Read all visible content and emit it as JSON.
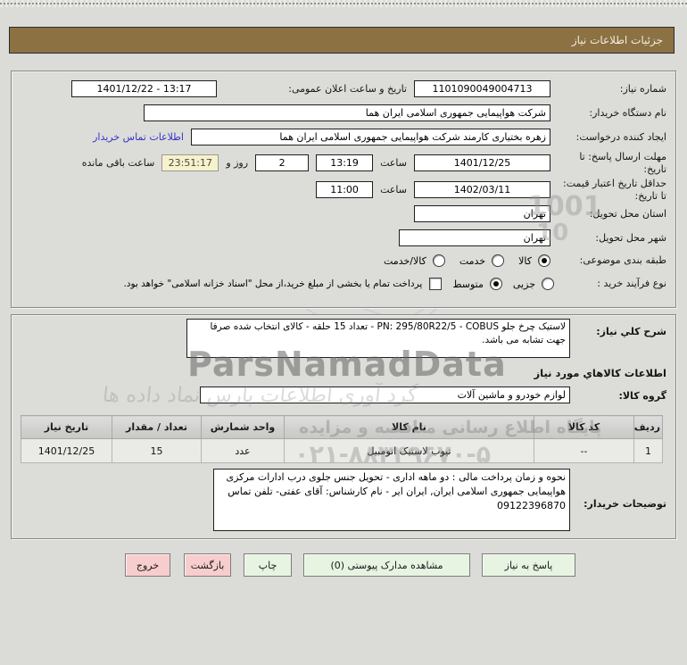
{
  "title_bar": {
    "text": "جزئیات اطلاعات نیاز"
  },
  "form": {
    "need_number": {
      "label": "شماره نیاز:",
      "value": "1101090049004713"
    },
    "announce_datetime": {
      "label": "تاریخ و ساعت اعلان عمومی:",
      "value": "13:17 - 1401/12/22"
    },
    "buyer_org": {
      "label": "نام دستگاه خریدار:",
      "value": "شرکت هواپیمایی جمهوری اسلامی ایران هما"
    },
    "request_creator": {
      "label": "ایجاد کننده درخواست:",
      "value": "زهره بختیاری کارمند شرکت هواپیمایی جمهوری اسلامی ایران هما",
      "contact_link": "اطلاعات تماس خریدار"
    },
    "response_deadline": {
      "label": "مهلت ارسال پاسخ: تا تاریخ:",
      "date": "1401/12/25",
      "hour_label": "ساعت",
      "time": "13:19",
      "days_value": "2",
      "days_label": "روز و",
      "countdown": "23:51:17",
      "countdown_label": "ساعت باقی مانده"
    },
    "price_validity": {
      "label": "حداقل تاریخ اعتبار قیمت: تا تاریخ:",
      "date": "1402/03/11",
      "hour_label": "ساعت",
      "time": "11:00"
    },
    "province": {
      "label": "استان محل تحویل:",
      "value": "تهران"
    },
    "city": {
      "label": "شهر محل تحویل:",
      "value": "تهران"
    },
    "subject_class": {
      "label": "طبقه بندی موضوعی:",
      "options": [
        {
          "label": "کالا",
          "selected": true
        },
        {
          "label": "خدمت",
          "selected": false
        },
        {
          "label": "کالا/خدمت",
          "selected": false
        }
      ]
    },
    "purchase_process": {
      "label": "نوع فرآیند خرید :",
      "options": [
        {
          "label": "جزیی",
          "selected": false
        },
        {
          "label": "متوسط",
          "selected": true
        }
      ],
      "checkbox_label": "پرداخت تمام یا بخشی از مبلغ خرید،از محل \"اسناد خزانه اسلامی\" خواهد بود.",
      "checkbox_checked": false
    }
  },
  "need_section": {
    "desc_label": "شرح کلي نیاز:",
    "desc_value": "لاستیک چرخ جلو PN: 295/80R22/5 - COBUS - تعداد 15 حلقه - کالای انتخاب شده صرفا جهت تشابه می باشد.",
    "items_header": "اطلاعات کالاهاي مورد نیاز",
    "group_label": "گروه کالا:",
    "group_value": "لوازم خودرو و ماشین آلات"
  },
  "items_table": {
    "headers": [
      "ردیف",
      "کد کالا",
      "نام کالا",
      "واحد شمارش",
      "تعداد / مقدار",
      "تاریخ نیاز"
    ],
    "rows": [
      [
        "1",
        "--",
        "تیوب لاستیک اتومبیل",
        "عدد",
        "15",
        "1401/12/25"
      ]
    ]
  },
  "buyer_notes": {
    "label": "توضیحات خریدار:",
    "value": "نحوه و زمان پرداخت مالی : دو ماهه اداری - تحویل جنس جلوی درب ادارات مرکزی هواپیمایی جمهوری اسلامی ایران, ایران ایر - نام کارشناس: آقای عفتی- تلفن تماس 09122396870"
  },
  "buttons": {
    "respond": "پاسخ به نیاز",
    "attachments": "مشاهده مدارک پیوستی (0)",
    "print": "چاپ",
    "back": "بازگشت",
    "exit": "خروج"
  },
  "watermarks": {
    "brand": "ParsNamadData",
    "calligraphy": "گرد آوری اطلاعات پارس نماد داده ها",
    "portal": "پایگاه اطلاع رسانی مناقصه و مزایده",
    "phone": "۰۲۱-۸۸۳۴۹۶۷۰-۵",
    "digits_a": "1001",
    "digits_b": "10"
  },
  "colors": {
    "title_bar_bg": "#8c7143",
    "page_bg": "#dbdbd8",
    "link": "#3434cb",
    "countdown_bg": "#f6f2cc",
    "button_green": "#e7f4e2",
    "button_pink": "#f7cdcd"
  }
}
